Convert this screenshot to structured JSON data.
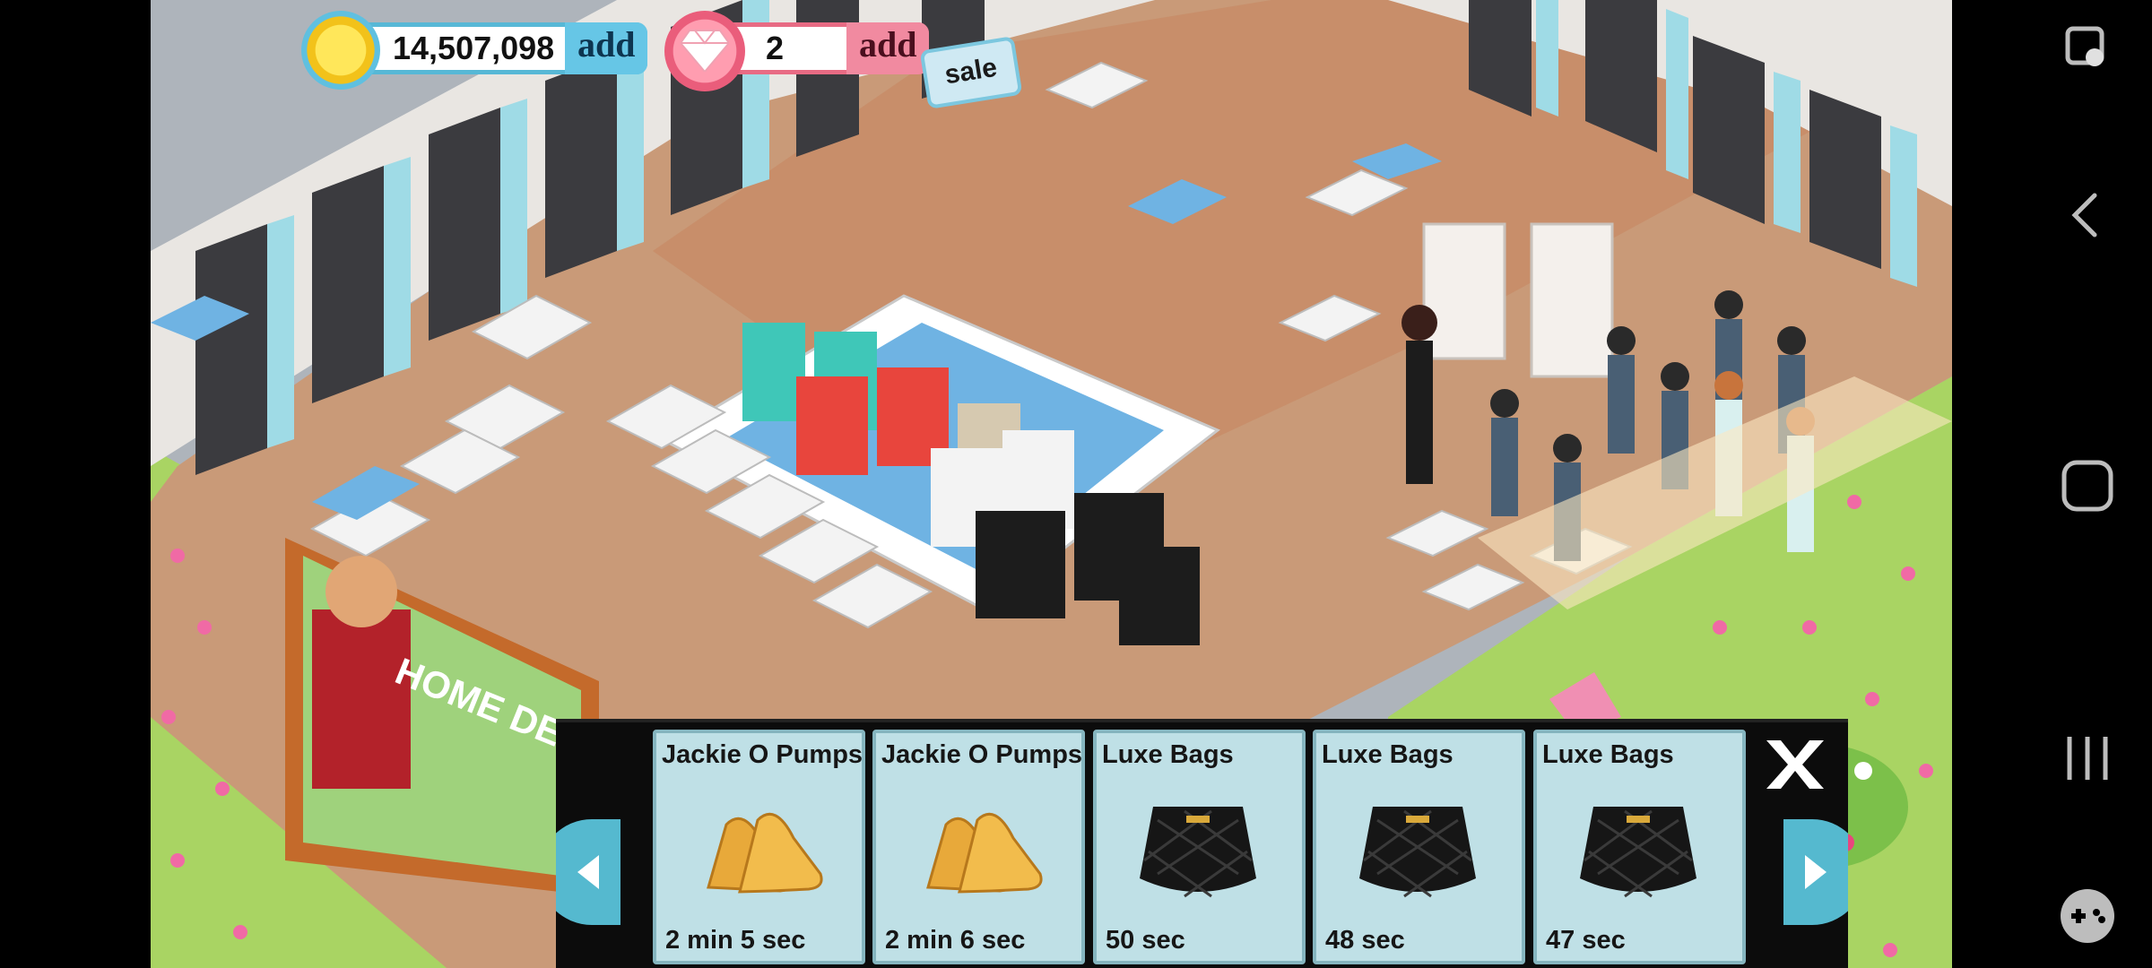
{
  "hud": {
    "coins": "14,507,098",
    "coins_add": "add",
    "gems": "2",
    "gems_add": "add",
    "sale": "sale"
  },
  "scene": {
    "billboard_text": "HOME DESIG"
  },
  "tray": {
    "items": [
      {
        "name": "Jackie O Pumps",
        "time": "2 min 5 sec",
        "icon": "pumps-icon"
      },
      {
        "name": "Jackie O Pumps",
        "time": "2 min 6 sec",
        "icon": "pumps-icon"
      },
      {
        "name": "Luxe Bags",
        "time": "50 sec",
        "icon": "bag-icon"
      },
      {
        "name": "Luxe Bags",
        "time": "48 sec",
        "icon": "bag-icon"
      },
      {
        "name": "Luxe Bags",
        "time": "47 sec",
        "icon": "bag-icon"
      }
    ]
  },
  "colors": {
    "floor": "#c99a78",
    "grass": "#a9d463",
    "coin_accent": "#57b8d6",
    "gem_accent": "#e86b84",
    "tray_bg": "#0c0c0c",
    "card_bg": "#bfe0e6"
  },
  "system_nav": [
    "screenshot-icon",
    "back-icon",
    "home-icon",
    "recents-icon",
    "game-controller-icon"
  ]
}
